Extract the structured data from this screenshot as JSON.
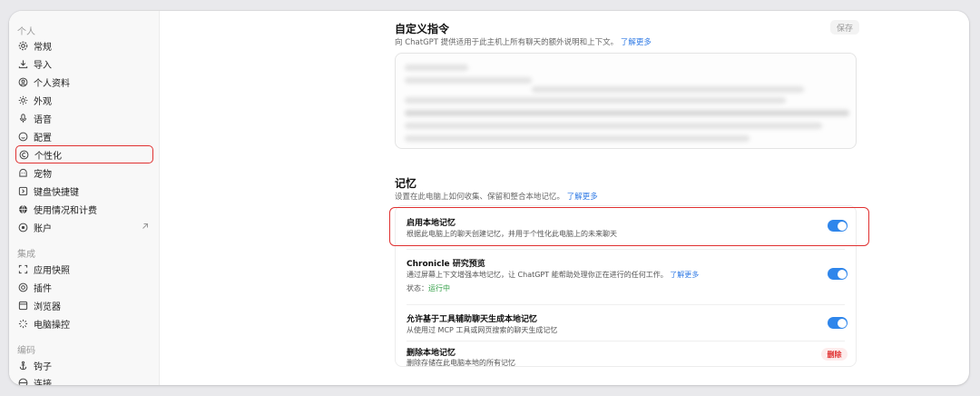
{
  "sidebar": {
    "groups": [
      {
        "label": "个人"
      },
      {
        "label": "集成"
      },
      {
        "label": "编码"
      }
    ],
    "items": [
      {
        "label": "常规",
        "icon": "gear-icon"
      },
      {
        "label": "导入",
        "icon": "download-icon"
      },
      {
        "label": "个人资料",
        "icon": "user-circle-icon"
      },
      {
        "label": "外观",
        "icon": "sun-icon"
      },
      {
        "label": "语音",
        "icon": "microphone-icon"
      },
      {
        "label": "配置",
        "icon": "smile-icon"
      },
      {
        "label": "个性化",
        "icon": "personalization-icon",
        "active": true
      },
      {
        "label": "宠物",
        "icon": "pet-icon"
      },
      {
        "label": "键盘快捷键",
        "icon": "keyboard-icon"
      },
      {
        "label": "使用情况和计费",
        "icon": "globe-icon"
      },
      {
        "label": "账户",
        "icon": "account-icon"
      },
      {
        "label": "应用快照",
        "icon": "snapshot-icon"
      },
      {
        "label": "插件",
        "icon": "plugin-icon"
      },
      {
        "label": "浏览器",
        "icon": "browser-icon"
      },
      {
        "label": "电脑操控",
        "icon": "computer-control-icon"
      },
      {
        "label": "钩子",
        "icon": "hook-icon"
      },
      {
        "label": "连接",
        "icon": "connection-icon"
      }
    ]
  },
  "custom_instructions": {
    "title": "自定义指令",
    "description": "向 ChatGPT 提供适用于此主机上所有聊天的额外说明和上下文。",
    "learn_more": "了解更多",
    "save_label": "保存"
  },
  "memory": {
    "title": "记忆",
    "description": "设置在此电脑上如何收集、保留和整合本地记忆。",
    "learn_more": "了解更多",
    "rows": [
      {
        "title": "启用本地记忆",
        "desc": "根据此电脑上的聊天创建记忆，并用于个性化此电脑上的未来聊天",
        "enabled": true
      },
      {
        "title": "Chronicle 研究预览",
        "desc": "通过屏幕上下文增强本地记忆，让 ChatGPT 能帮助处理你正在进行的任何工作。",
        "learn_more": "了解更多",
        "status_label": "状态：",
        "status_value": "运行中",
        "enabled": true
      },
      {
        "title": "允许基于工具辅助聊天生成本地记忆",
        "desc": "从使用过 MCP 工具或网页搜索的聊天生成记忆",
        "enabled": true
      },
      {
        "title": "删除本地记忆",
        "desc": "删除存储在此电脑本地的所有记忆",
        "action_label": "删除"
      }
    ]
  },
  "colors": {
    "accent": "#2f86eb",
    "danger": "#e03131",
    "success": "#2f9e44"
  }
}
